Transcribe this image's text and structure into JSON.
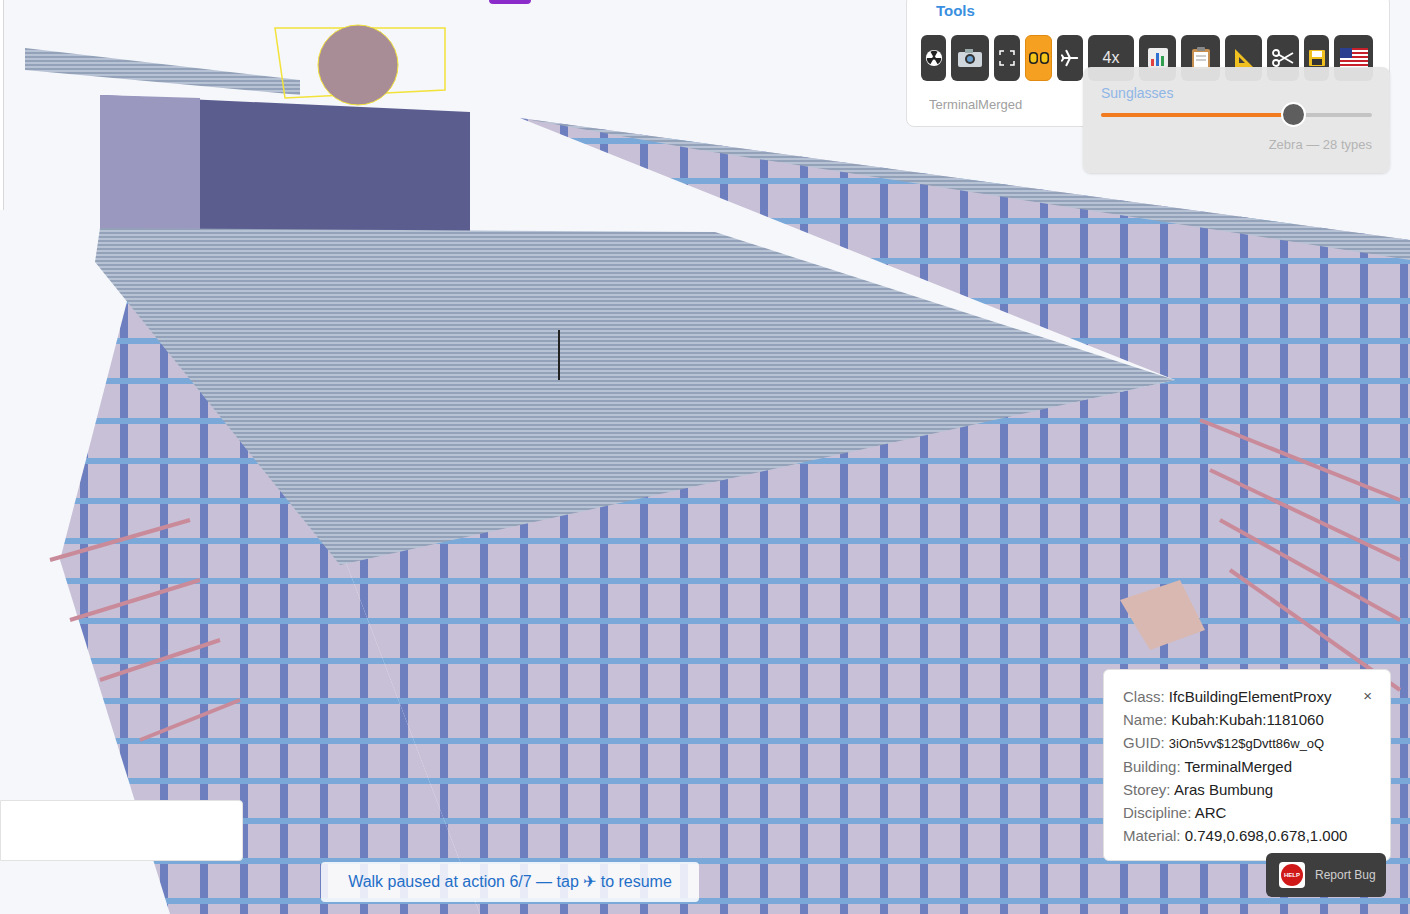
{
  "viewport": {
    "selected_element": true
  },
  "tools": {
    "title": "Tools",
    "buttons": [
      {
        "kind": "icon",
        "selected": false
      },
      {
        "kind": "icon",
        "selected": false
      },
      {
        "kind": "icon",
        "selected": false
      },
      {
        "kind": "icon",
        "selected": true
      },
      {
        "kind": "icon",
        "selected": false
      },
      {
        "kind": "text",
        "label": "4x",
        "selected": false
      },
      {
        "kind": "icon",
        "selected": false
      },
      {
        "kind": "icon",
        "selected": false
      },
      {
        "kind": "icon",
        "selected": false
      },
      {
        "kind": "icon",
        "selected": false
      },
      {
        "kind": "icon",
        "selected": false
      },
      {
        "kind": "icon",
        "selected": false
      }
    ],
    "building": "TerminalMerged"
  },
  "popup": {
    "title": "Sunglasses",
    "level": 0.71,
    "caption": "Zebra — 28 types"
  },
  "properties": {
    "close": "×",
    "rows": [
      {
        "key": "Class",
        "value": "IfcBuildingElementProxy"
      },
      {
        "key": "Name",
        "value": "Kubah:Kubah:1181060"
      },
      {
        "key": "GUID",
        "value": "3iOn5vv$12$gDvtt86w_oQ"
      },
      {
        "key": "Building",
        "value": "TerminalMerged"
      },
      {
        "key": "Storey",
        "value": "Aras Bumbung"
      },
      {
        "key": "Discipline",
        "value": "ARC"
      },
      {
        "key": "Material",
        "value": "0.749,0.698,0.678,1.000"
      }
    ]
  },
  "toast": "Walk paused at action 6/7 — tap ✈ to resume",
  "report_bug": {
    "icon_text": "HELP",
    "label": "Report Bug"
  }
}
